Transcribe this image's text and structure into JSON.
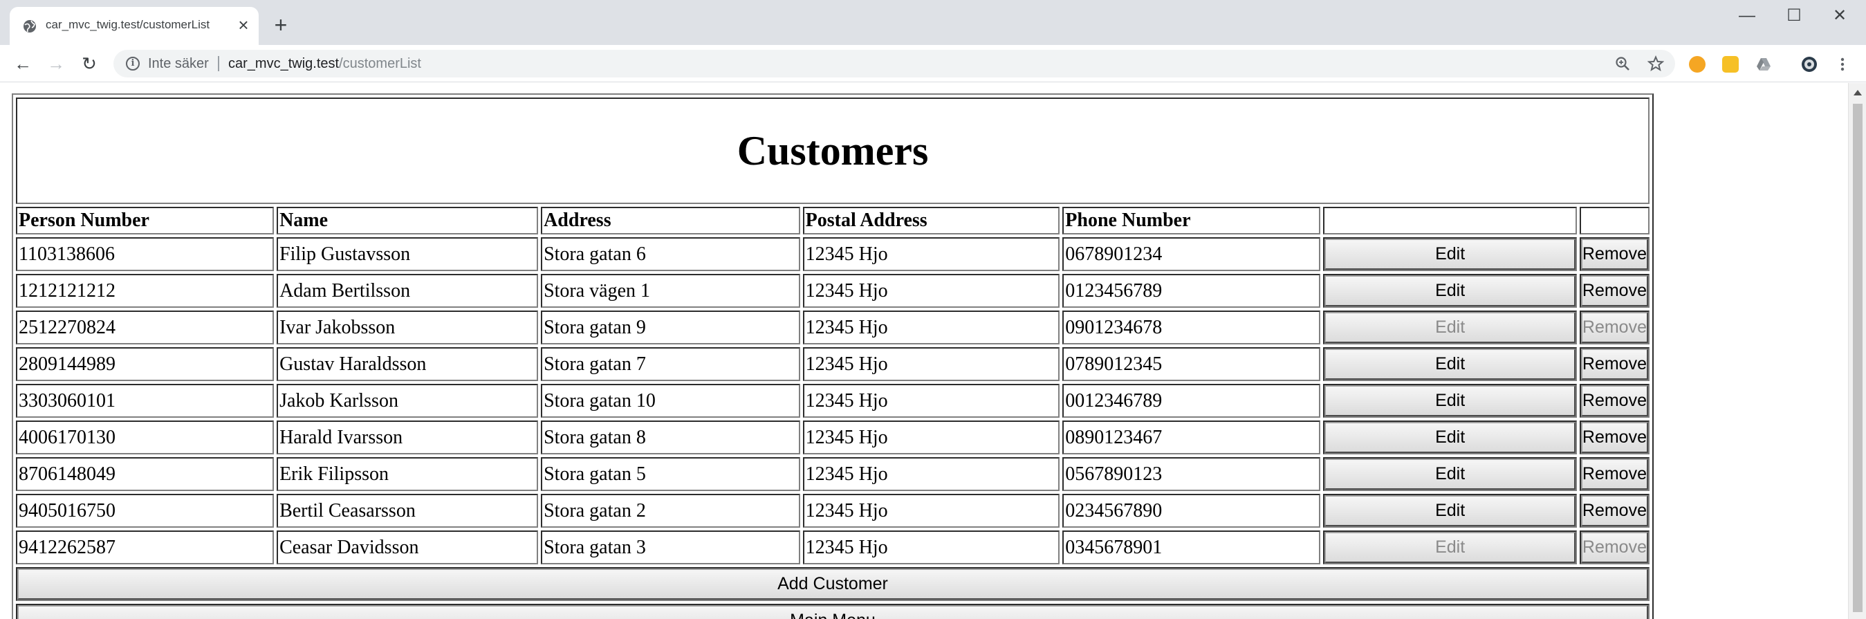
{
  "browser": {
    "tab_title": "car_mvc_twig.test/customerList",
    "tab_close": "×",
    "new_tab": "+",
    "security_label": "Inte säker",
    "url_host": "car_mvc_twig.test",
    "url_path": "/customerList",
    "window_controls": {
      "minimize": "—",
      "maximize": "☐",
      "close": "✕"
    },
    "nav": {
      "back": "←",
      "forward": "→",
      "reload": "↻"
    },
    "icons": {
      "zoom": "zoom-icon",
      "bookmark": "star-icon",
      "menu": "kebab-menu-icon"
    }
  },
  "page": {
    "title": "Customers",
    "columns": [
      "Person Number",
      "Name",
      "Address",
      "Postal Address",
      "Phone Number",
      "",
      ""
    ],
    "edit_label": "Edit",
    "remove_label": "Remove",
    "add_label": "Add Customer",
    "main_menu_label": "Main Menu",
    "rows": [
      {
        "person_number": "1103138606",
        "name": "Filip Gustavsson",
        "address": "Stora gatan 6",
        "postal": "12345 Hjo",
        "phone": "0678901234",
        "enabled": true
      },
      {
        "person_number": "1212121212",
        "name": "Adam Bertilsson",
        "address": "Stora vägen 1",
        "postal": "12345 Hjo",
        "phone": "0123456789",
        "enabled": true
      },
      {
        "person_number": "2512270824",
        "name": "Ivar Jakobsson",
        "address": "Stora gatan 9",
        "postal": "12345 Hjo",
        "phone": "0901234678",
        "enabled": false
      },
      {
        "person_number": "2809144989",
        "name": "Gustav Haraldsson",
        "address": "Stora gatan 7",
        "postal": "12345 Hjo",
        "phone": "0789012345",
        "enabled": true
      },
      {
        "person_number": "3303060101",
        "name": "Jakob Karlsson",
        "address": "Stora gatan 10",
        "postal": "12345 Hjo",
        "phone": "0012346789",
        "enabled": true
      },
      {
        "person_number": "4006170130",
        "name": "Harald Ivarsson",
        "address": "Stora gatan 8",
        "postal": "12345 Hjo",
        "phone": "0890123467",
        "enabled": true
      },
      {
        "person_number": "8706148049",
        "name": "Erik Filipsson",
        "address": "Stora gatan 5",
        "postal": "12345 Hjo",
        "phone": "0567890123",
        "enabled": true
      },
      {
        "person_number": "9405016750",
        "name": "Bertil Ceasarsson",
        "address": "Stora gatan 2",
        "postal": "12345 Hjo",
        "phone": "0234567890",
        "enabled": true
      },
      {
        "person_number": "9412262587",
        "name": "Ceasar Davidsson",
        "address": "Stora gatan 3",
        "postal": "12345 Hjo",
        "phone": "0345678901",
        "enabled": false
      }
    ]
  },
  "colors": {
    "tabbar": "#dee1e6",
    "omnibox": "#f1f3f4",
    "disabled_text": "#8a8a8a"
  }
}
